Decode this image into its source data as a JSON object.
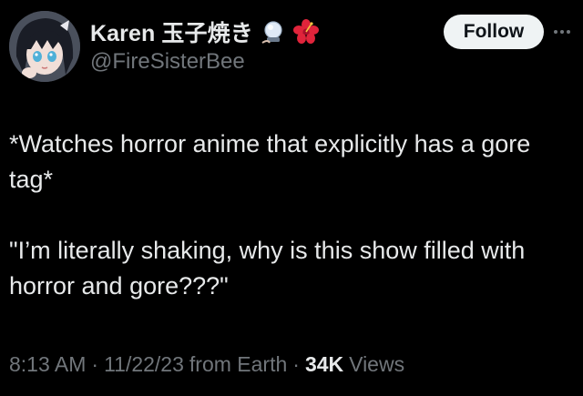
{
  "author": {
    "display_name": "Karen 玉子焼き",
    "handle": "@FireSisterBee",
    "badges": [
      "crystal-ball-icon",
      "hibiscus-icon"
    ],
    "avatar": "anime-avatar"
  },
  "actions": {
    "follow_label": "Follow",
    "more_icon": "more-options-icon"
  },
  "tweet": {
    "paragraphs": [
      "*Watches horror anime that explicitly has a gore tag*",
      "\"I’m literally shaking, why is this show filled with horror and gore???\""
    ]
  },
  "meta": {
    "time": "8:13 AM",
    "date": "11/22/23",
    "source": "from Earth",
    "views_count": "34K",
    "views_label": "Views",
    "separator": "·"
  },
  "colors": {
    "background": "#000000",
    "text_primary": "#e7e9ea",
    "text_secondary": "#71767b",
    "follow_bg": "#eff3f4"
  }
}
